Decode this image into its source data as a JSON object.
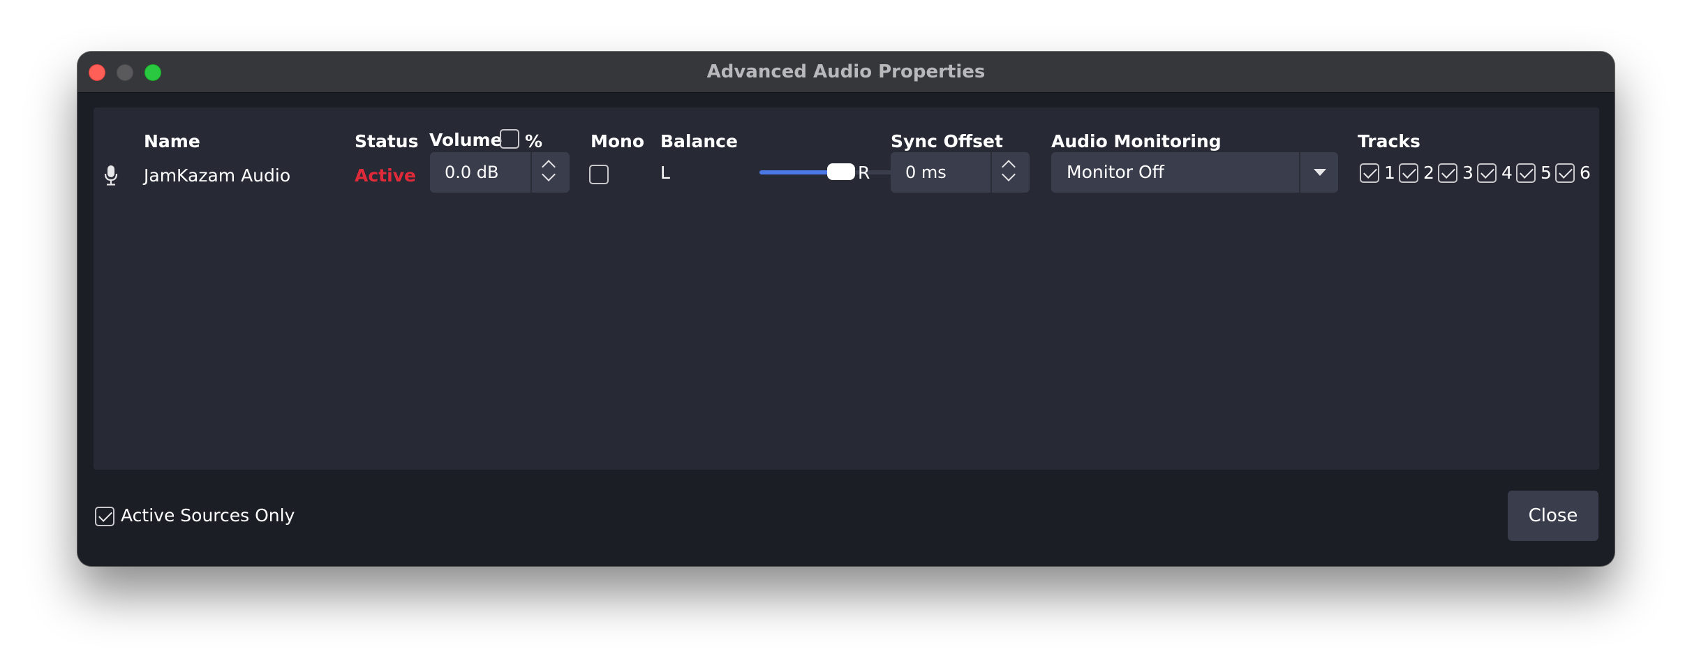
{
  "window": {
    "title": "Advanced Audio Properties"
  },
  "columns": {
    "name": "Name",
    "status": "Status",
    "volume": "Volume",
    "percent": "%",
    "mono": "Mono",
    "balance": "Balance",
    "sync_offset": "Sync Offset",
    "audio_monitoring": "Audio Monitoring",
    "tracks": "Tracks"
  },
  "source": {
    "icon": "microphone-icon",
    "name": "JamKazam Audio",
    "status": "Active",
    "status_color": "#e02a3a",
    "volume": "0.0 dB",
    "percent_checked": false,
    "mono_checked": false,
    "balance_left": "L",
    "balance_right": "R",
    "balance_value": 0.5,
    "sync_offset": "0 ms",
    "monitoring": "Monitor Off",
    "tracks": [
      {
        "label": "1",
        "checked": true
      },
      {
        "label": "2",
        "checked": true
      },
      {
        "label": "3",
        "checked": true
      },
      {
        "label": "4",
        "checked": true
      },
      {
        "label": "5",
        "checked": true
      },
      {
        "label": "6",
        "checked": true
      }
    ]
  },
  "footer": {
    "active_sources_only_label": "Active Sources Only",
    "active_sources_only_checked": true,
    "close_label": "Close"
  },
  "colors": {
    "accent": "#4b78e6",
    "background": "#1c1e26",
    "panel": "#272a35"
  }
}
